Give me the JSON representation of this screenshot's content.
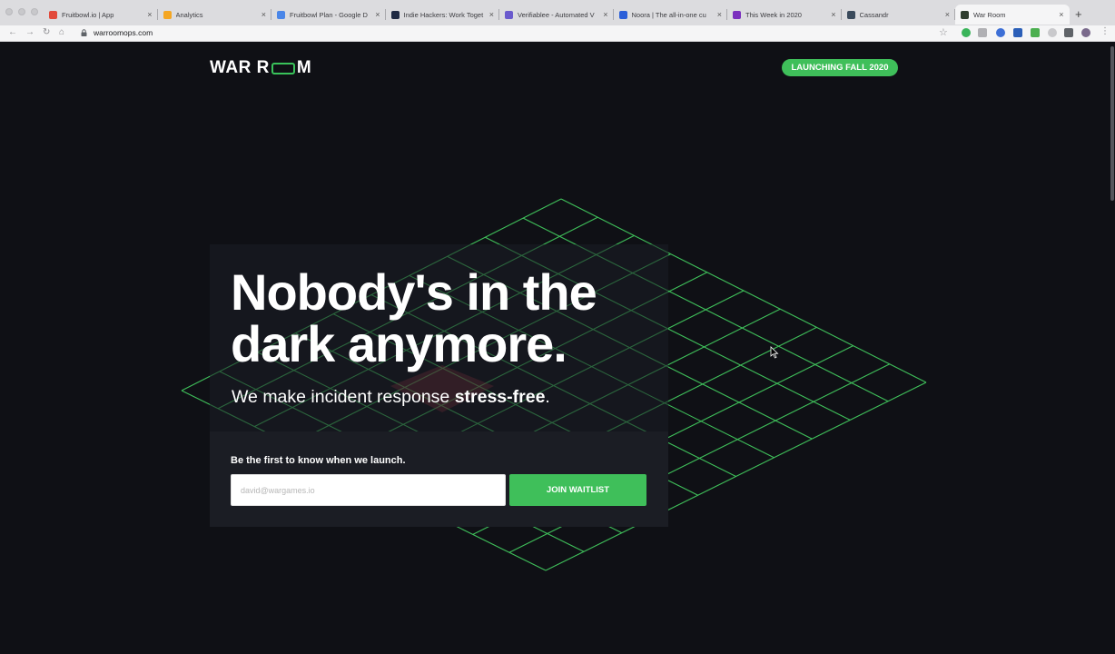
{
  "browser": {
    "tabs": [
      {
        "title": "Fruitbowl.io | App",
        "favicon_color": "#e24a3b"
      },
      {
        "title": "Analytics",
        "favicon_color": "#f4a623"
      },
      {
        "title": "Fruitbowl Plan - Google D",
        "favicon_color": "#4a86e8"
      },
      {
        "title": "Indie Hackers: Work Toget",
        "favicon_color": "#1f2a44"
      },
      {
        "title": "Verifiablee - Automated V",
        "favicon_color": "#6a5acd"
      },
      {
        "title": "Noora | The all-in-one cu",
        "favicon_color": "#2b5fd9"
      },
      {
        "title": "This Week in 2020",
        "favicon_color": "#7b2fbe"
      },
      {
        "title": "Cassandr",
        "favicon_color": "#3a4a5c"
      },
      {
        "title": "War Room",
        "favicon_color": "#2f3d2f"
      }
    ],
    "active_tab": 8,
    "new_tab_label": "+",
    "close_glyph": "×",
    "url": "warroomops.com"
  },
  "page": {
    "logo": {
      "left": "WAR R",
      "right": "M"
    },
    "launch_badge": "LAUNCHING FALL 2020",
    "headline_line1": "Nobody's in the",
    "headline_line2": "dark anymore.",
    "subhead_prefix": "We make incident response ",
    "subhead_bold": "stress-free",
    "subhead_suffix": ".",
    "cta_label": "Be the first to know when we launch.",
    "email_placeholder": "david@wargames.io",
    "join_button": "JOIN WAITLIST",
    "colors": {
      "accent": "#3fbf5a",
      "background": "#0f1015",
      "highlight": "#c8424a"
    }
  }
}
